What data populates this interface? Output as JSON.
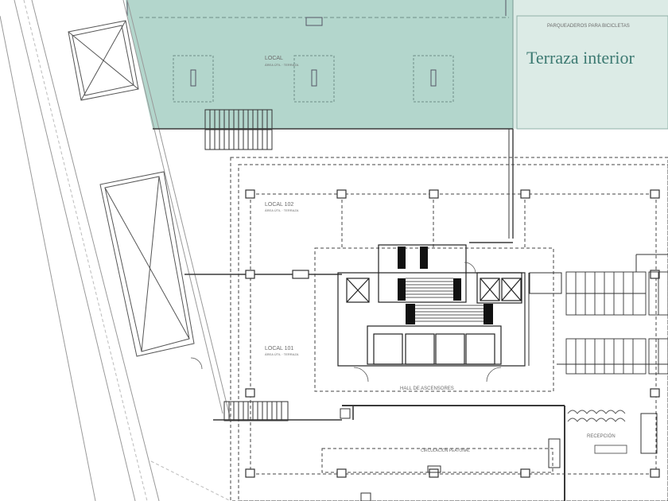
{
  "title": "Terraza interior",
  "labels": {
    "local_top": "LOCAL",
    "local_top_sub": "ÁREA ÚTIL · TERRAZA",
    "local_102": "LOCAL 102",
    "local_102_sub": "ÁREA ÚTIL · TERRAZA",
    "local_101": "LOCAL 101",
    "local_101_sub": "ÁREA ÚTIL · TERRAZA",
    "hall": "HALL DE ASCENSORES",
    "bike_parking": "PARQUEADEROS PARA BICICLETAS",
    "reception": "RECEPCIÓN",
    "corridor": "CIRCULACIÓN PEATONAL"
  },
  "colors": {
    "terrace_fill": "#b3d6cc",
    "annex_fill": "#dcebe6",
    "title": "#3d7a72",
    "line": "#3a3a3a"
  }
}
